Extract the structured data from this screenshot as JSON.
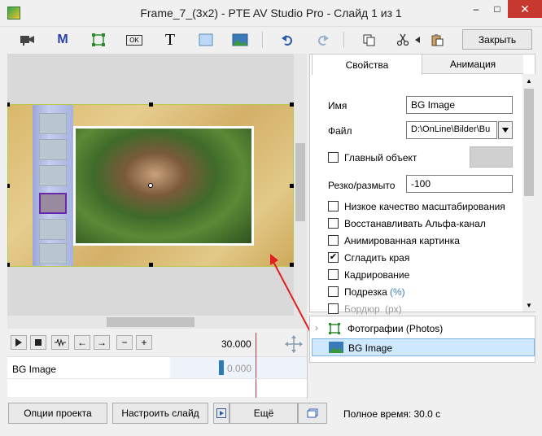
{
  "window": {
    "title": "Frame_7_(3x2) - PTE AV Studio Pro - Слайд 1 из 1",
    "minimize": "–",
    "maximize": "□",
    "close": "✕"
  },
  "toolbar": {
    "close_label": "Закрыть",
    "text_tool": "T",
    "mask_tool": "M",
    "ok_badge": "OK"
  },
  "tabs": {
    "properties": "Свойства",
    "animation": "Анимация"
  },
  "properties": {
    "name_label": "Имя",
    "name_value": "BG Image",
    "file_label": "Файл",
    "file_value": "D:\\OnLine\\Bilder\\Bu",
    "main_object_label": "Главный объект",
    "sharpness_label": "Резко/размыто",
    "sharpness_value": "-100",
    "options": [
      {
        "label": "Низкое качество масштабирования",
        "checked": false
      },
      {
        "label": "Восстанавливать Альфа-канал",
        "checked": false
      },
      {
        "label": "Анимированная картинка",
        "checked": false
      },
      {
        "label": "Сгладить края",
        "checked": true
      },
      {
        "label": "Кадрирование",
        "checked": false
      },
      {
        "label": "Подрезка",
        "suffix": "(%)",
        "checked": false
      },
      {
        "label": "Бордюр",
        "suffix": "(px)",
        "checked": false
      }
    ]
  },
  "tree": {
    "items": [
      {
        "label": "Фотографии (Photos)"
      },
      {
        "label": "BG Image"
      }
    ]
  },
  "timeline": {
    "time_marker": "30.000",
    "track_label": "BG Image",
    "keyframe_time": "0.000"
  },
  "bottom": {
    "project_options": "Опции проекта",
    "customize_slide": "Настроить слайд",
    "more": "Ещё",
    "total_time": "Полное время: 30.0 с"
  },
  "colors": {
    "accent_blue": "#3c7fb1",
    "selection": "#cde8ff",
    "arrow_red": "#e02020",
    "playhead": "#c8323c"
  }
}
